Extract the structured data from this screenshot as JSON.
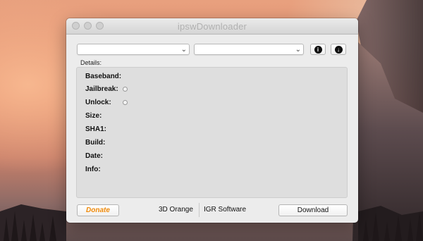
{
  "window": {
    "title": "ipswDownloader",
    "device_select": {
      "value": ""
    },
    "firmware_select": {
      "value": ""
    },
    "info_button_icon": "info-icon",
    "download_icon_button_icon": "download-arrow-icon"
  },
  "details": {
    "label": "Details:",
    "fields": {
      "baseband": "Baseband:",
      "jailbreak": "Jailbreak:",
      "unlock": "Unlock:",
      "size": "Size:",
      "sha1": "SHA1:",
      "build": "Build:",
      "date": "Date:",
      "info": "Info:"
    }
  },
  "footer": {
    "donate_label": "Donate",
    "link_left": "3D Orange",
    "link_right": "IGR Software",
    "download_label": "Download"
  },
  "colors": {
    "donate_accent": "#f08a0a",
    "window_bg": "#ececec",
    "group_bg": "#dedede"
  }
}
